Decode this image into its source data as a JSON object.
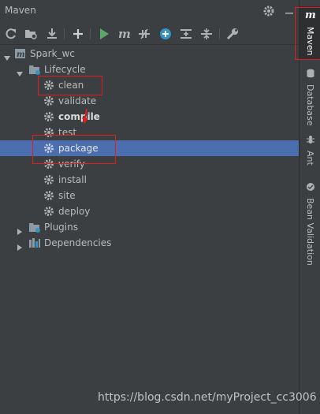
{
  "panel": {
    "title": "Maven"
  },
  "toolbar": {
    "icons": [
      "refresh-icon",
      "reimport-folder-icon",
      "download-icon",
      "add-icon",
      "run-icon",
      "maven-m-icon",
      "toggle-offline-icon",
      "lifecycle-icon",
      "collapse-icon",
      "expand-icon",
      "wrench-icon"
    ]
  },
  "tree": {
    "project": "Spark_wc",
    "lifecycle": "Lifecycle",
    "goals": [
      "clean",
      "validate",
      "compile",
      "test",
      "package",
      "verify",
      "install",
      "site",
      "deploy"
    ],
    "plugins": "Plugins",
    "dependencies": "Dependencies"
  },
  "side_tabs": {
    "maven": "Maven",
    "database": "Database",
    "ant": "Ant",
    "bean_validation": "Bean Validation"
  },
  "colors": {
    "background": "#3c3f41",
    "selection": "#4b6eaf",
    "annotation": "#e02020"
  },
  "watermark": "https://blog.csdn.net/myProject_cc3006"
}
